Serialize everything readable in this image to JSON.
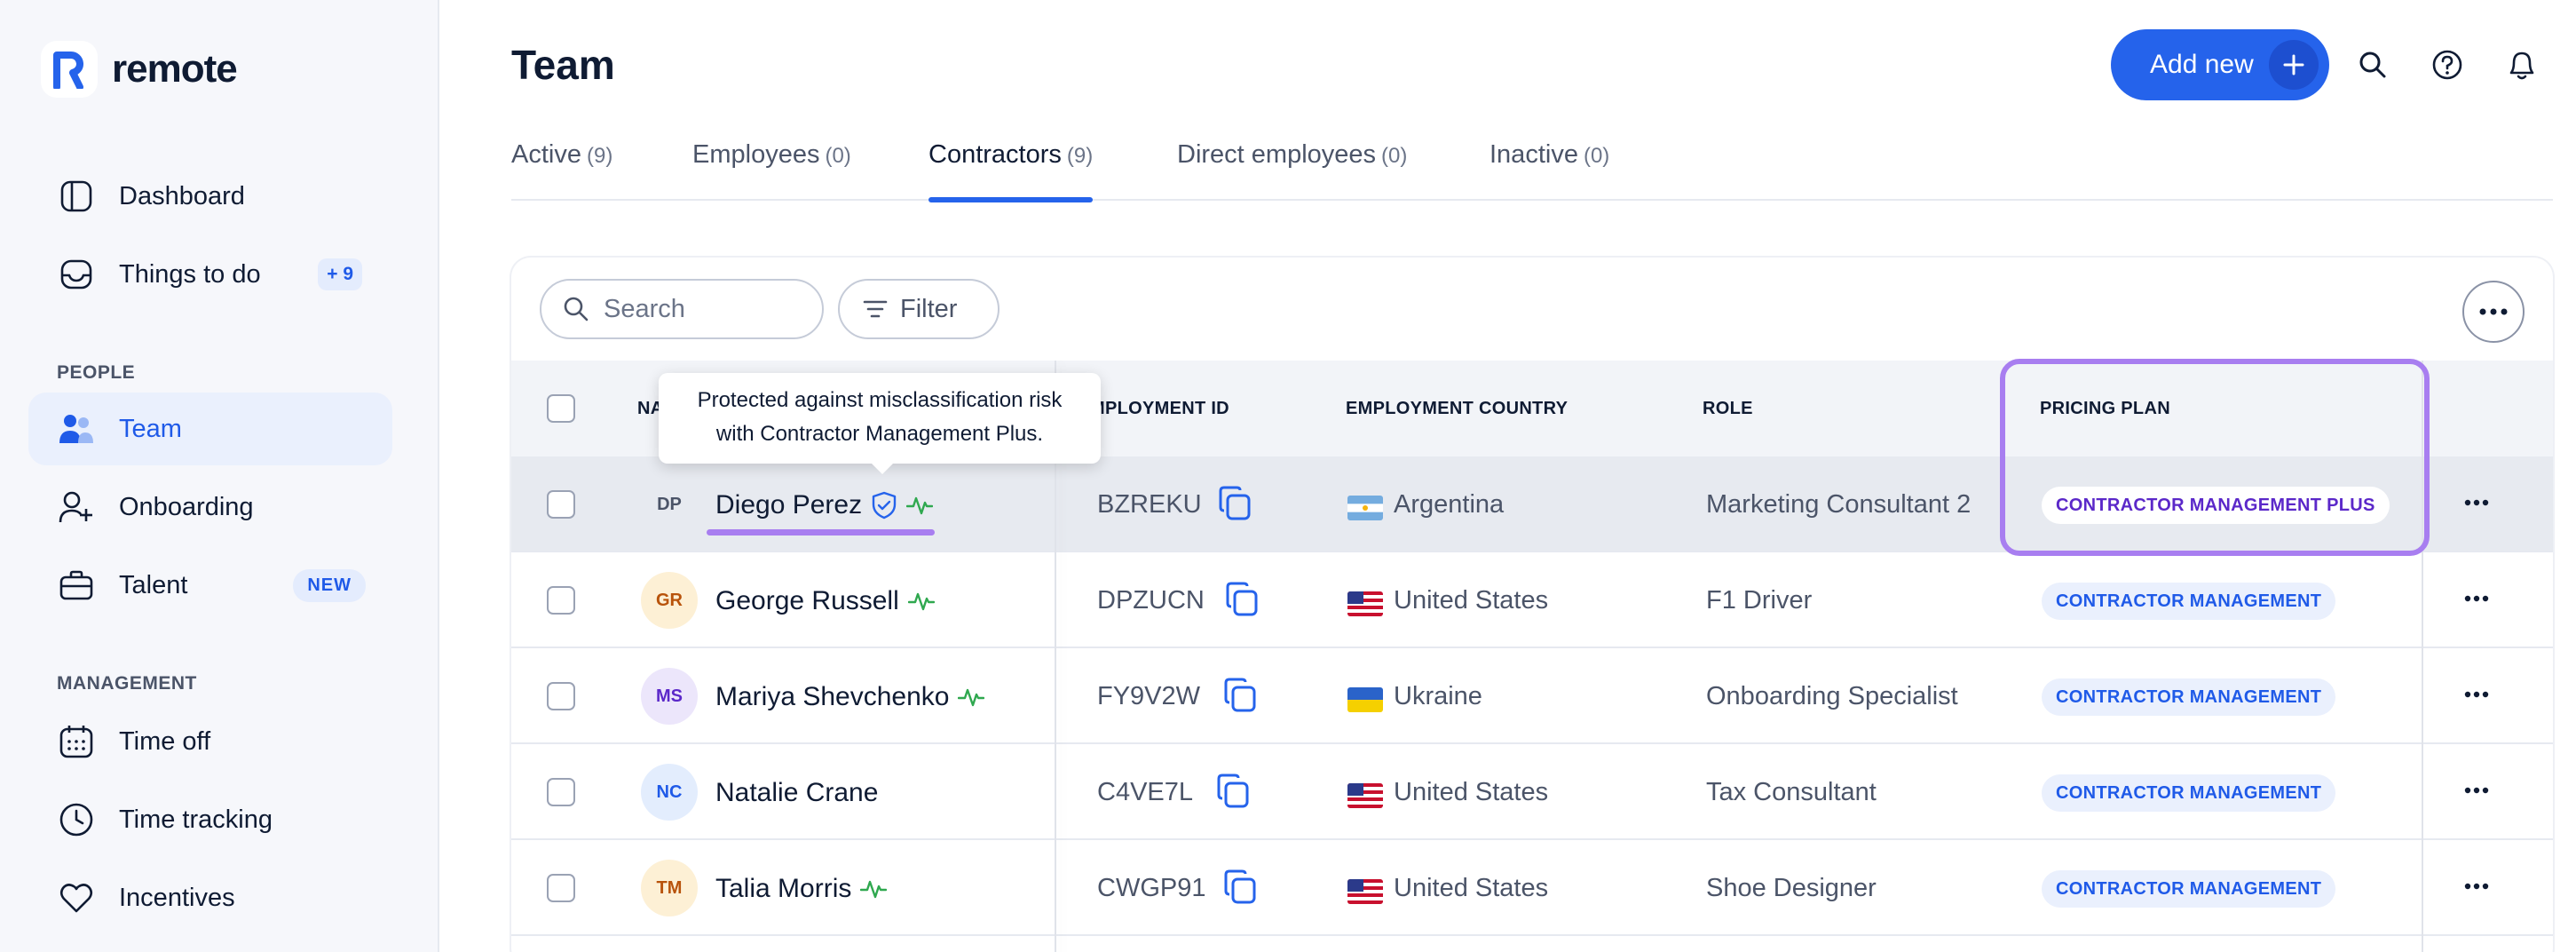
{
  "app": {
    "name": "remote"
  },
  "sidebar": {
    "items": [
      {
        "label": "Dashboard"
      },
      {
        "label": "Things to do",
        "badge": "+ 9"
      },
      {
        "label": "Team"
      },
      {
        "label": "Onboarding"
      },
      {
        "label": "Talent",
        "badge": "NEW"
      },
      {
        "label": "Time off"
      },
      {
        "label": "Time tracking"
      },
      {
        "label": "Incentives"
      }
    ],
    "sections": {
      "people": "PEOPLE",
      "management": "MANAGEMENT"
    }
  },
  "header": {
    "title": "Team",
    "add_label": "Add new"
  },
  "tabs": [
    {
      "label": "Active",
      "count": "(9)"
    },
    {
      "label": "Employees",
      "count": "(0)"
    },
    {
      "label": "Contractors",
      "count": "(9)"
    },
    {
      "label": "Direct employees",
      "count": "(0)"
    },
    {
      "label": "Inactive",
      "count": "(0)"
    }
  ],
  "toolbar": {
    "search_placeholder": "Search",
    "filter_label": "Filter"
  },
  "table": {
    "columns": {
      "name": "NA",
      "employment_id": "MPLOYMENT ID",
      "country": "EMPLOYMENT COUNTRY",
      "role": "ROLE",
      "plan": "PRICING PLAN"
    },
    "rows": [
      {
        "initials": "DP",
        "name": "Diego Perez",
        "id": "BZREKU",
        "country": "Argentina",
        "role": "Marketing Consultant 2",
        "plan": "CONTRACTOR MANAGEMENT PLUS"
      },
      {
        "initials": "GR",
        "name": "George Russell",
        "id": "DPZUCN",
        "country": "United States",
        "role": "F1 Driver",
        "plan": "CONTRACTOR MANAGEMENT"
      },
      {
        "initials": "MS",
        "name": "Mariya Shevchenko",
        "id": "FY9V2W",
        "country": "Ukraine",
        "role": "Onboarding Specialist",
        "plan": "CONTRACTOR MANAGEMENT"
      },
      {
        "initials": "NC",
        "name": "Natalie Crane",
        "id": "C4VE7L",
        "country": "United States",
        "role": "Tax Consultant",
        "plan": "CONTRACTOR MANAGEMENT"
      },
      {
        "initials": "TM",
        "name": "Talia Morris",
        "id": "CWGP91",
        "country": "United States",
        "role": "Shoe Designer",
        "plan": "CONTRACTOR MANAGEMENT"
      }
    ]
  },
  "tooltip": {
    "line1": "Protected against misclassification risk",
    "line2": "with Contractor Management Plus."
  },
  "colors": {
    "accent": "#2563eb",
    "highlight": "#a87ef0",
    "status_green": "#2fa84f"
  }
}
